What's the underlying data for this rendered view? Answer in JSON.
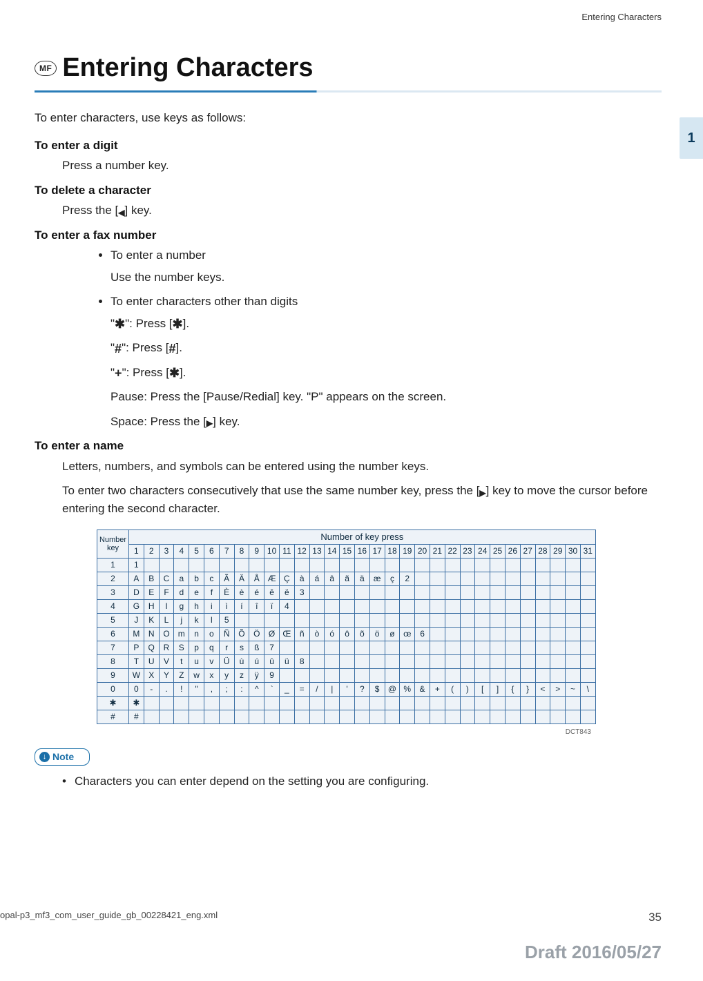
{
  "header": {
    "running": "Entering Characters"
  },
  "title": {
    "badge": "MF",
    "text": "Entering Characters"
  },
  "tab": {
    "label": "1"
  },
  "body": {
    "intro": "To enter characters, use keys as follows:",
    "digit_head": "To enter a digit",
    "digit_text": "Press a number key.",
    "delete_head": "To delete a character",
    "delete_text_prefix": "Press the [",
    "delete_text_suffix": "] key.",
    "fax_head": "To enter a fax number",
    "fax_num_bullet": "To enter a number",
    "fax_num_text": "Use the number keys.",
    "fax_other_bullet": "To enter characters other than digits",
    "star_prefix": "\"",
    "star_mid": "\": Press [",
    "star_suffix": "].",
    "hash_prefix": "\"",
    "hash_mid": "\": Press [",
    "hash_suffix": "].",
    "plus_line_prefix": "\"",
    "plus_char": "+",
    "plus_mid": "\": Press [",
    "plus_suffix": "].",
    "pause_line": "Pause: Press the [Pause/Redial] key. \"P\" appears on the screen.",
    "space_prefix": "Space: Press the [",
    "space_suffix": "] key.",
    "name_head": "To enter a name",
    "name_p1": "Letters, numbers, and symbols can be entered using the number keys.",
    "name_p2_prefix": "To enter two characters consecutively that use the same number key, press the [",
    "name_p2_suffix": "] key to move the cursor before entering the second character."
  },
  "table": {
    "corner_top": "Number",
    "corner_bottom": "key",
    "header_title": "Number of key press",
    "cols": [
      "1",
      "2",
      "3",
      "4",
      "5",
      "6",
      "7",
      "8",
      "9",
      "10",
      "11",
      "12",
      "13",
      "14",
      "15",
      "16",
      "17",
      "18",
      "19",
      "20",
      "21",
      "22",
      "23",
      "24",
      "25",
      "26",
      "27",
      "28",
      "29",
      "30",
      "31"
    ],
    "rows": [
      {
        "key": "1",
        "cells": [
          "1"
        ]
      },
      {
        "key": "2",
        "cells": [
          "A",
          "B",
          "C",
          "a",
          "b",
          "c",
          "Ã",
          "Ä",
          "Å",
          "Æ",
          "Ç",
          "à",
          "á",
          "â",
          "ã",
          "ä",
          "æ",
          "ç",
          "2"
        ]
      },
      {
        "key": "3",
        "cells": [
          "D",
          "E",
          "F",
          "d",
          "e",
          "f",
          "È",
          "è",
          "é",
          "ê",
          "ë",
          "3"
        ]
      },
      {
        "key": "4",
        "cells": [
          "G",
          "H",
          "I",
          "g",
          "h",
          "i",
          "ì",
          "í",
          "î",
          "ï",
          "4"
        ]
      },
      {
        "key": "5",
        "cells": [
          "J",
          "K",
          "L",
          "j",
          "k",
          "l",
          "5"
        ]
      },
      {
        "key": "6",
        "cells": [
          "M",
          "N",
          "O",
          "m",
          "n",
          "o",
          "Ñ",
          "Õ",
          "Ö",
          "Ø",
          "Œ",
          "ñ",
          "ò",
          "ó",
          "ô",
          "õ",
          "ö",
          "ø",
          "œ",
          "6"
        ]
      },
      {
        "key": "7",
        "cells": [
          "P",
          "Q",
          "R",
          "S",
          "p",
          "q",
          "r",
          "s",
          "ß",
          "7"
        ]
      },
      {
        "key": "8",
        "cells": [
          "T",
          "U",
          "V",
          "t",
          "u",
          "v",
          "Ü",
          "ù",
          "ú",
          "û",
          "ü",
          "8"
        ]
      },
      {
        "key": "9",
        "cells": [
          "W",
          "X",
          "Y",
          "Z",
          "w",
          "x",
          "y",
          "z",
          "ÿ",
          "9"
        ]
      },
      {
        "key": "0",
        "cells": [
          "0",
          "-",
          ".",
          "!",
          "\"",
          ",",
          ";",
          ":",
          "^",
          "`",
          "_",
          "=",
          "/",
          "|",
          "'",
          "?",
          "$",
          "@",
          "%",
          "&",
          "+",
          "(",
          ")",
          "[",
          "]",
          "{",
          "}",
          "<",
          ">",
          "~",
          "\\"
        ]
      },
      {
        "key": "✱",
        "cells": [
          "✱"
        ]
      },
      {
        "key": "#",
        "cells": [
          "#"
        ]
      }
    ],
    "code": "DCT843"
  },
  "note": {
    "label": "Note",
    "bullet": "Characters you can enter depend on the setting you are configuring."
  },
  "footer": {
    "left": "opal-p3_mf3_com_user_guide_gb_00228421_eng.xml",
    "right": "35"
  },
  "draft": "Draft 2016/05/27"
}
